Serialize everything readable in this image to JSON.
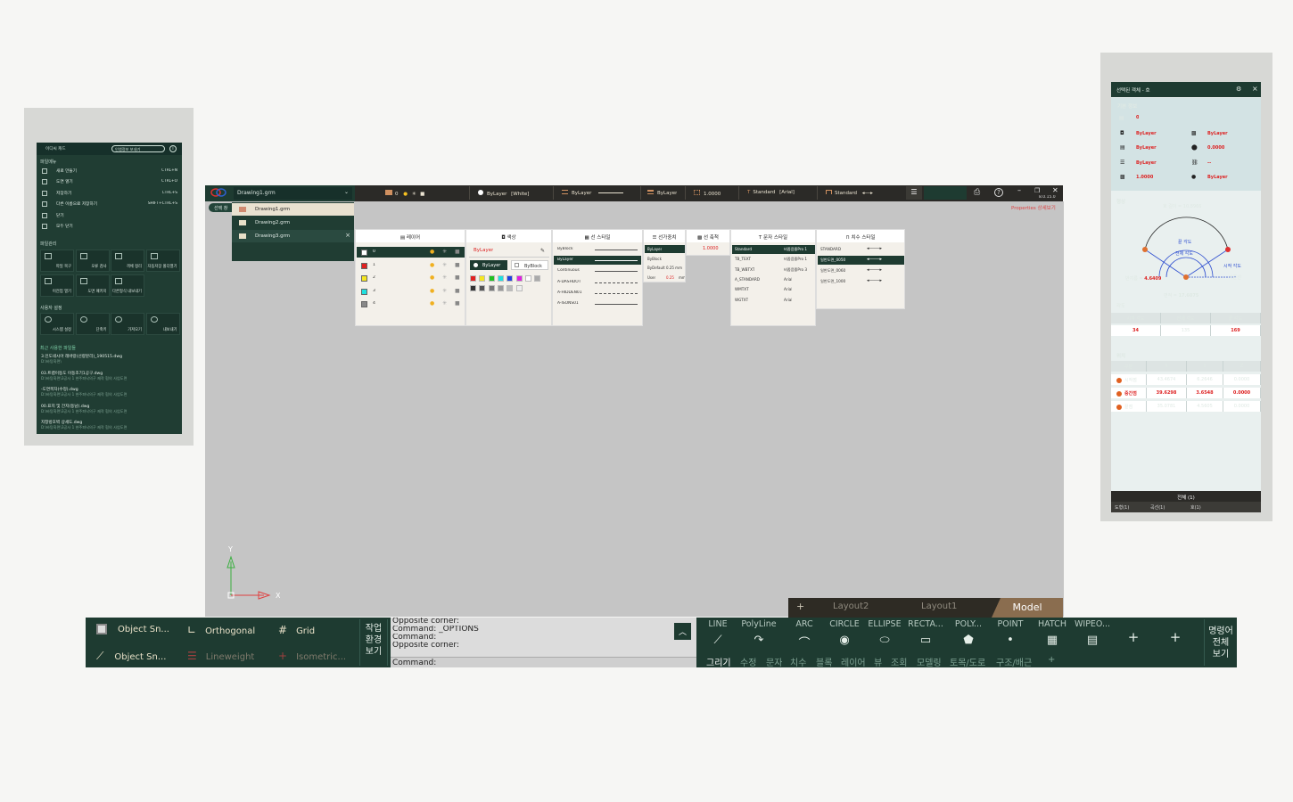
{
  "left_panel": {
    "header_left": "이디씨 캐드",
    "header_button": "인앱정보 보내기",
    "sections": {
      "file_menu": "파일메뉴",
      "file_manage": "파일관리",
      "user_settings": "사용자 설정",
      "recent": "최근 사용한 파일들"
    },
    "file_menu_items": [
      {
        "label": "새로 만들기",
        "shortcut": "CTRL+N"
      },
      {
        "label": "도면 열기",
        "shortcut": "CTRL+O"
      },
      {
        "label": "저장하기",
        "shortcut": "CTRL+S"
      },
      {
        "label": "다른 이름으로 저장하기",
        "shortcut": "SHIFT+CTRL+S"
      },
      {
        "label": "닫기",
        "shortcut": ""
      },
      {
        "label": "모두 닫기",
        "shortcut": ""
      }
    ],
    "file_tiles": [
      "파일 복구",
      "오류 검사",
      "객체 정리",
      "자동저장 폴더열기",
      "이전업 열기",
      "도면 패키지",
      "다른형식 내보내기"
    ],
    "user_tiles": [
      "시스템 설정",
      "단축키",
      "가져오기",
      "내보내기"
    ],
    "recent_files": [
      {
        "name": "3.인도네시아 레바랑(선량분리)_190515.dwg",
        "path": "D:\\바탕화면\\"
      },
      {
        "name": "03.트랩이동도 이동조기1공구.dwg",
        "path": "D:\\바탕화면\\3공사 1 현주파낙의구 제작 협의 사업도면"
      },
      {
        "name": "-도면목차(수정).dwg",
        "path": "D:\\바탕화면\\3공사 1 현주파낙의구 제작 협의 사업도면"
      },
      {
        "name": "00.표지 및 간지(동남).dwg",
        "path": "D:\\바탕화면\\3공사 1 현주파낙의구 제작 협의 사업도면"
      },
      {
        "name": "지창방호벽 상세도.dwg",
        "path": "D:\\바탕화면\\3공사 1 현주파낙의구 제작 협의 사업도면"
      }
    ]
  },
  "topbar": {
    "drawing_combo": "Drawing1.grm",
    "layer_value": "0",
    "color_value": "ByLayer",
    "color_name": "[White]",
    "linetype_value": "ByLayer",
    "lineweight_value": "ByLayer",
    "ltscale_value": "1.0000",
    "textstyle_value": "Standard",
    "textstyle_font": "[Arial]",
    "dimstyle_value": "Standard",
    "version": "8.0.15.0",
    "sub_tab": "선택 창",
    "properties_link": "Properties 상세보기"
  },
  "drawings": [
    {
      "name": "Drawing1.grm",
      "active": true
    },
    {
      "name": "Drawing2.grm",
      "active": false
    },
    {
      "name": "Drawing3.grm",
      "active": false
    }
  ],
  "panels": {
    "layer": {
      "title": "레이어",
      "rows": [
        "0",
        "1",
        "2",
        "3",
        "4"
      ],
      "colors": [
        "#ffffff",
        "#e02020",
        "#f5e620",
        "#20e0e0",
        "#888888"
      ]
    },
    "color": {
      "title": "색상",
      "current": "ByLayer",
      "opt1": "ByLayer",
      "opt2": "ByBlock",
      "swatches": [
        "#e02020",
        "#f5e620",
        "#20c020",
        "#20e0e0",
        "#2040e0",
        "#e020e0",
        "#ffffff",
        "#aaaaaa",
        "#333333",
        "#555555",
        "#777777",
        "#999999",
        "#bbbbbb",
        "#eeeeee"
      ]
    },
    "linetype": {
      "title": "선 스타일",
      "rows": [
        "ByBlock",
        "ByLayer",
        "Continuous",
        "A-DASHDOT",
        "A-HIDDEN01",
        "A-ISONS01"
      ]
    },
    "lineweight": {
      "title": "선가중치",
      "rows": [
        "ByLayer",
        "ByBlock",
        "ByDefault",
        "User"
      ],
      "vals": [
        "",
        "",
        "0.25 mm",
        "0.25"
      ],
      "unit": "mm"
    },
    "ltscale": {
      "title": "선 축척",
      "value": "1.0000"
    },
    "textstyle": {
      "title": "문자 스타일",
      "rows": [
        "Standard",
        "TB_TEXT",
        "TB_WBTXT",
        "A_STANDARD",
        "WMTXT",
        "WGTXT"
      ],
      "fonts": [
        "비좁음즐Pro 1",
        "비좁음즐Pro 1",
        "비좁음즐Pro 3",
        "Arial",
        "Arial",
        "Arial"
      ]
    },
    "dimstyle": {
      "title": "치수 스타일",
      "rows": [
        "STANDARD",
        "일반도면_0050",
        "일반도면_0060",
        "일반도면_1000"
      ]
    }
  },
  "properties": {
    "title": "선택된 객체 - 호",
    "basic_info": "기본 정보",
    "layer": "0",
    "color": "ByLayer",
    "transparency": "ByLayer",
    "linetype": "ByLayer",
    "thickness": "0.0000",
    "lineweight": "ByLayer",
    "hyperlink": "--",
    "ltscale": "1.0000",
    "plotstyle": "ByLayer",
    "shape_title": "형상",
    "arc_length": "호 길이 = 10.8966",
    "arc_label": "끝 각도",
    "total_label": "전체 각도",
    "start_label": "시작 각도",
    "radius_label": "반지름 =",
    "radius_value": "4.6409",
    "baseline_label": "기준선",
    "area_label": "면적 =",
    "area_value": "17.6075",
    "angle_title": "각도",
    "angle_headers": [
      "시작 각도",
      "전체 각도",
      "끝 각도"
    ],
    "angle_values": [
      "34",
      "135",
      "169"
    ],
    "position_title": "위치",
    "pos_headers": [
      "구분",
      "X",
      "Y",
      "Z"
    ],
    "pos_rows": [
      {
        "label": "시작점",
        "x": "43.4674",
        "y": "6.2646",
        "z": "0.0000"
      },
      {
        "label": "중간점",
        "x": "39.6298",
        "y": "3.6548",
        "z": "0.0000"
      },
      {
        "label": "끝점",
        "x": "35.0781",
        "y": "4.5605",
        "z": "0.0000"
      }
    ],
    "total_btn": "전체 (1)",
    "filter_tabs": [
      "도형(1)",
      "곡선(1)",
      "호(1)"
    ]
  },
  "layout_tabs": {
    "add": "+",
    "tab1": "Layout2",
    "tab2": "Layout1",
    "model": "Model"
  },
  "axes": {
    "y": "Y",
    "x": "X"
  },
  "status_bar": {
    "osnap1": "Object Sn...",
    "ortho": "Orthogonal",
    "grid": "Grid",
    "osnap2": "Object Sn...",
    "lineweight": "Lineweight",
    "iso": "Isometric...",
    "work_env": [
      "작업",
      "환경",
      "보기"
    ]
  },
  "command": {
    "lines": [
      "Opposite corner:",
      "Command: _OPTIONS",
      "Command:",
      "Opposite corner:"
    ],
    "prompt": "Command:"
  },
  "draw_tools": {
    "tools": [
      "LINE",
      "PolyLine",
      "ARC",
      "CIRCLE",
      "ELLIPSE",
      "RECTA...",
      "POLY...",
      "POINT",
      "HATCH",
      "WIPEO..."
    ],
    "plus": "+",
    "categories": [
      "그리기",
      "수정",
      "문자",
      "치수",
      "블록",
      "레이어",
      "뷰",
      "조회",
      "모델링",
      "토목/도로",
      "구조/배근",
      "+"
    ],
    "cmd_all": [
      "명령어",
      "전체",
      "보기"
    ]
  }
}
